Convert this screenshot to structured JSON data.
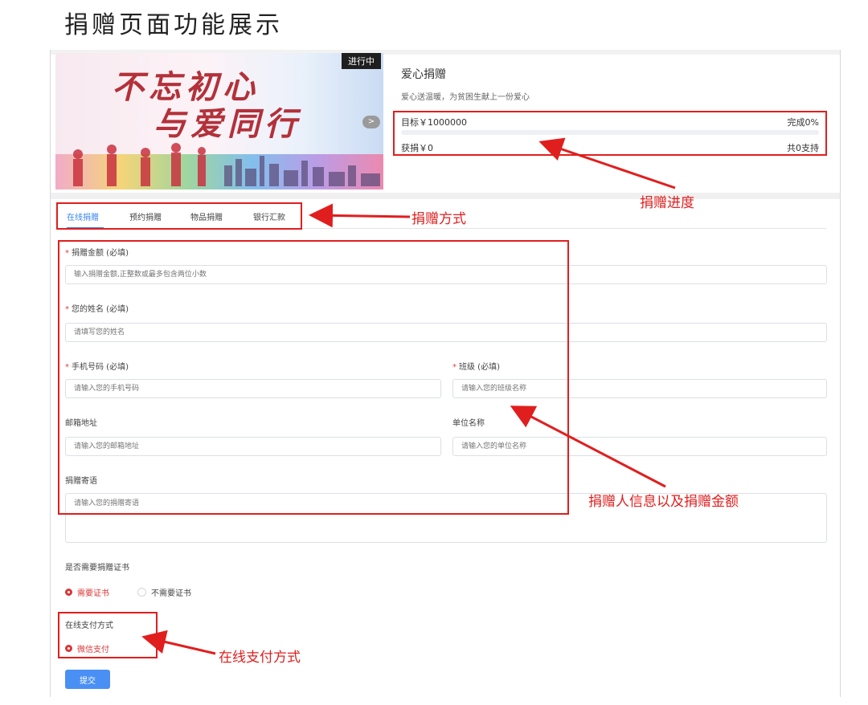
{
  "doc_title": "捐赠页面功能展示",
  "banner": {
    "slogan_line1": "不忘初心",
    "slogan_line2": "与爱同行",
    "status_badge": "进行中",
    "next_icon": "chevron-right-icon"
  },
  "project": {
    "title": "爱心捐赠",
    "description": "爱心送温暖，为贫困生献上一份爱心",
    "target_label": "目标￥1000000",
    "completion_label": "完成0%",
    "completion": 0,
    "raised_label": "获捐￥0",
    "supporters_label": "共0支持"
  },
  "tabs": [
    {
      "label": "在线捐赠",
      "active": true
    },
    {
      "label": "预约捐赠",
      "active": false
    },
    {
      "label": "物品捐赠",
      "active": false
    },
    {
      "label": "银行汇款",
      "active": false
    }
  ],
  "form": {
    "amount": {
      "label": "捐赠金额 (必填)",
      "placeholder": "输入捐赠金额,正整数或最多包含两位小数"
    },
    "name": {
      "label": "您的姓名 (必填)",
      "placeholder": "请填写您的姓名"
    },
    "phone": {
      "label": "手机号码 (必填)",
      "placeholder": "请输入您的手机号码"
    },
    "class": {
      "label": "班级 (必填)",
      "placeholder": "请输入您的班级名称"
    },
    "email": {
      "label": "邮箱地址",
      "placeholder": "请输入您的邮箱地址"
    },
    "company": {
      "label": "单位名称",
      "placeholder": "请输入您的单位名称"
    },
    "message": {
      "label": "捐赠寄语",
      "placeholder": "请输入您的捐赠寄语"
    },
    "certificate": {
      "question": "是否需要捐赠证书",
      "options": [
        "需要证书",
        "不需要证书"
      ],
      "selected": "需要证书"
    },
    "payment": {
      "label": "在线支付方式",
      "options": [
        "微信支付"
      ],
      "selected": "微信支付"
    },
    "submit_label": "提交"
  },
  "annotations": {
    "progress": "捐赠进度",
    "method": "捐赠方式",
    "donor_info": "捐赠人信息以及捐赠金额",
    "payment": "在线支付方式"
  },
  "colors": {
    "accent": "#3a86f2",
    "highlight_red": "#e11e1e",
    "submit_blue": "#4a8ff4"
  }
}
